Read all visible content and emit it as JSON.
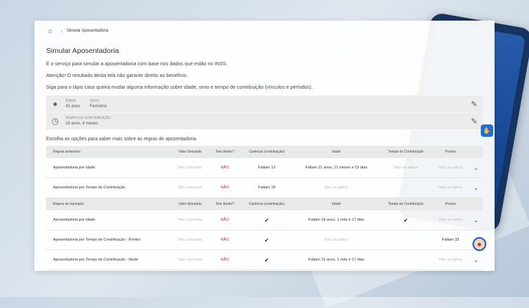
{
  "breadcrumb": {
    "current": "Simular Aposentadoria"
  },
  "title": "Simular Aposentadoria",
  "paragraphs": [
    "É o serviço para simular a aposentadoria com base nos dados que estão no INSS.",
    "Atenção! O resultado desta tela não garante direito ao benefício.",
    "Siga para o lápis caso queira mudar alguma informação sobre idade, sexo e tempo de contribuição (vínculos e períodos)."
  ],
  "info": {
    "idade_label": "IDADE",
    "idade_value": "43 anos",
    "sexo_label": "SEXO",
    "sexo_value": "Feminino",
    "tempo_label": "TEMPO DE CONTRIBUIÇÃO",
    "tempo_value": "18 anos, 4 meses"
  },
  "choose_text": "Escolha as opções para saber mais sobre as regras de aposentadoria.",
  "table1": {
    "headers": [
      "Regras anteriores",
      "Valor Simulado",
      "Tem direito?",
      "Carência (contribuição)",
      "Idade",
      "Tempo de Contribuição",
      "Pontos"
    ],
    "rows": [
      [
        "Aposentadoria por Idade",
        "Não calculado",
        "NÃO",
        "Faltam 13",
        "Faltam 21 anos, 11 meses e 15 dias",
        "Não se aplica",
        "Não se aplica"
      ],
      [
        "Aposentadoria por Tempo de Contribuição",
        "Não calculado",
        "NÃO",
        "Faltam 18",
        "Não se aplica",
        "-",
        "Não se aplica"
      ]
    ]
  },
  "table2": {
    "headers": [
      "Regras de transição",
      "Valor Simulado",
      "Tem direito?",
      "Carência (contribuição)",
      "Idade",
      "Tempo de Contribuição",
      "Pontos"
    ],
    "rows": [
      [
        "Aposentadoria por Idade",
        "Não calculado",
        "NÃO",
        "✔",
        "Faltam 18 anos, 1 mês e 17 dias",
        "✔",
        "Não se aplica"
      ],
      [
        "Aposentadoria por Tempo de Contribuição - Pontos",
        "Não calculado",
        "NÃO",
        "✔",
        "Não se aplica",
        "-",
        "Faltam 33"
      ],
      [
        "Aposentadoria por Tempo de Contribuição - Idade",
        "Não calculado",
        "NÃO",
        "✔",
        "Faltam 15 anos, 1 mês e 17 dias",
        "",
        "Não se aplica"
      ]
    ]
  },
  "icons": {
    "home": "home-icon",
    "user": "user-icon",
    "clock": "clock-icon",
    "edit": "edit-icon",
    "chevron": "chevron-down-icon"
  }
}
